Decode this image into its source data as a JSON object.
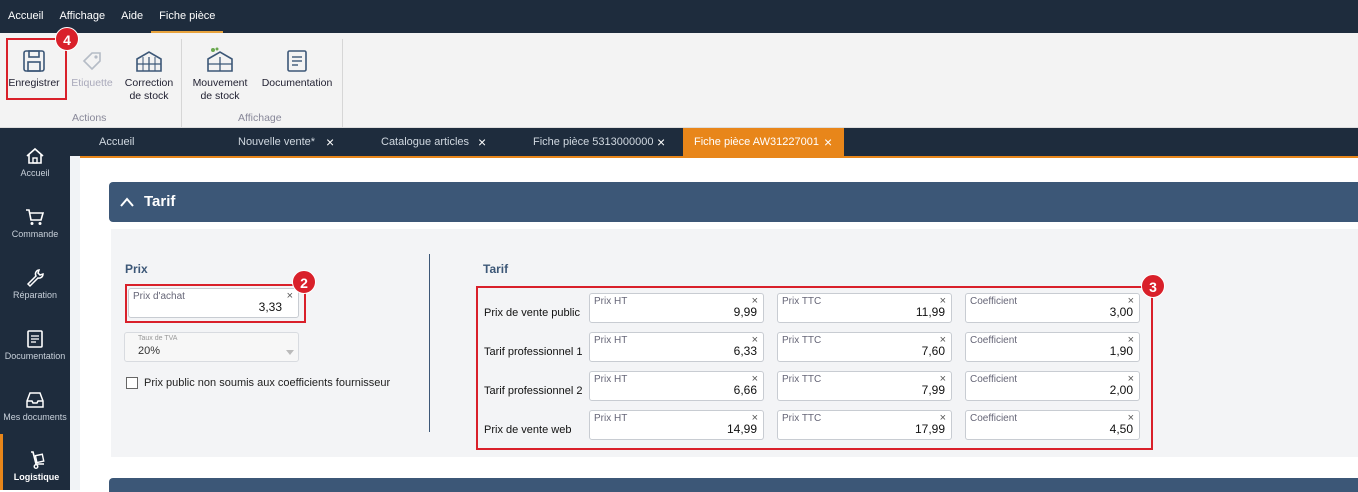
{
  "menu": [
    "Accueil",
    "Affichage",
    "Aide",
    "Fiche pièce"
  ],
  "ribbon": {
    "buttons": [
      {
        "label1": "Enregistrer",
        "label2": "",
        "icon": "save-icon"
      },
      {
        "label1": "Etiquette",
        "label2": "",
        "icon": "tag-icon"
      },
      {
        "label1": "Correction",
        "label2": "de stock",
        "icon": "warehouse-icon"
      },
      {
        "label1": "Mouvement",
        "label2": "de stock",
        "icon": "warehouse-move-icon"
      },
      {
        "label1": "Documentation",
        "label2": "",
        "icon": "document-icon"
      }
    ],
    "groups": [
      "Actions",
      "Affichage"
    ]
  },
  "badges": [
    "4",
    "2",
    "3"
  ],
  "sidebar": [
    {
      "label": "Accueil",
      "icon": "home-icon"
    },
    {
      "label": "Commande",
      "icon": "cart-icon"
    },
    {
      "label": "Réparation",
      "icon": "wrench-icon"
    },
    {
      "label": "Documentation",
      "icon": "document-icon"
    },
    {
      "label": "Mes documents",
      "icon": "inbox-icon"
    },
    {
      "label": "Logistique",
      "icon": "hand-truck-icon"
    }
  ],
  "tabs": [
    {
      "label": "Accueil",
      "closable": false
    },
    {
      "label": "Nouvelle vente*",
      "closable": true
    },
    {
      "label": "Catalogue articles",
      "closable": true
    },
    {
      "label": "Fiche pièce 5313000000",
      "closable": true
    },
    {
      "label": "Fiche pièce AW31227001",
      "closable": true
    }
  ],
  "section": {
    "title": "Tarif",
    "chevron": "^"
  },
  "prix": {
    "heading": "Prix",
    "prix_achat_label": "Prix d'achat",
    "prix_achat_value": "3,33",
    "tva_label": "Taux de TVA",
    "tva_value": "20%",
    "checkbox_label": "Prix public non soumis aux coefficients fournisseur"
  },
  "tarif": {
    "heading": "Tarif",
    "rows": [
      {
        "label": "Prix de vente public",
        "ht": "9,99",
        "ttc": "11,99",
        "coef": "3,00"
      },
      {
        "label": "Tarif professionnel 1",
        "ht": "6,33",
        "ttc": "7,60",
        "coef": "1,90"
      },
      {
        "label": "Tarif professionnel 2",
        "ht": "6,66",
        "ttc": "7,99",
        "coef": "2,00"
      },
      {
        "label": "Prix de vente web",
        "ht": "14,99",
        "ttc": "17,99",
        "coef": "4,50"
      }
    ],
    "col_labels": {
      "ht": "Prix HT",
      "ttc": "Prix TTC",
      "coef": "Coefficient"
    }
  },
  "clear_glyph": "×",
  "colors": {
    "navy": "#1e2c3d",
    "accent": "#e8861a",
    "section": "#3c5777",
    "highlight": "#d9202a"
  }
}
